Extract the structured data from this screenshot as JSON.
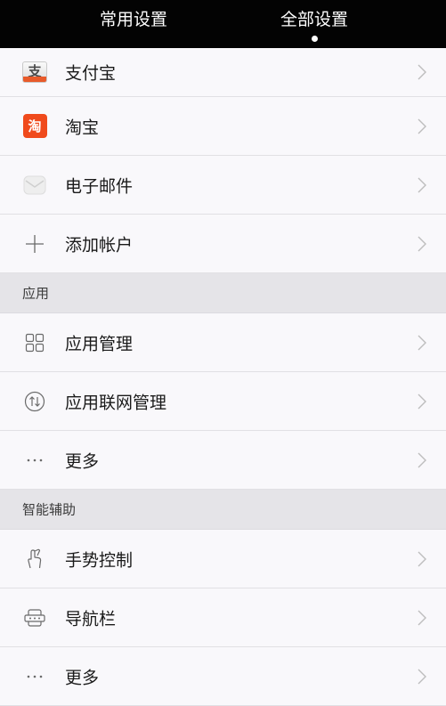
{
  "tabs": [
    {
      "label": "常用设置",
      "active": false
    },
    {
      "label": "全部设置",
      "active": true
    }
  ],
  "accounts": {
    "items": [
      {
        "label": "支付宝",
        "icon": "alipay-icon"
      },
      {
        "label": "淘宝",
        "icon": "taobao-icon"
      },
      {
        "label": "电子邮件",
        "icon": "mail-icon"
      },
      {
        "label": "添加帐户",
        "icon": "plus-icon"
      }
    ]
  },
  "apps": {
    "title": "应用",
    "items": [
      {
        "label": "应用管理",
        "icon": "grid-icon"
      },
      {
        "label": "应用联网管理",
        "icon": "network-icon"
      },
      {
        "label": "更多",
        "icon": "more-icon"
      }
    ]
  },
  "assist": {
    "title": "智能辅助",
    "items": [
      {
        "label": "手势控制",
        "icon": "gesture-icon"
      },
      {
        "label": "导航栏",
        "icon": "navbar-icon"
      },
      {
        "label": "更多",
        "icon": "more-icon"
      }
    ]
  },
  "colors": {
    "topbar": "#030303",
    "row": "#f9f8fb",
    "section": "#e5e4e8",
    "taobao": "#f04a1c",
    "alipay_band": "#e85a2a"
  }
}
